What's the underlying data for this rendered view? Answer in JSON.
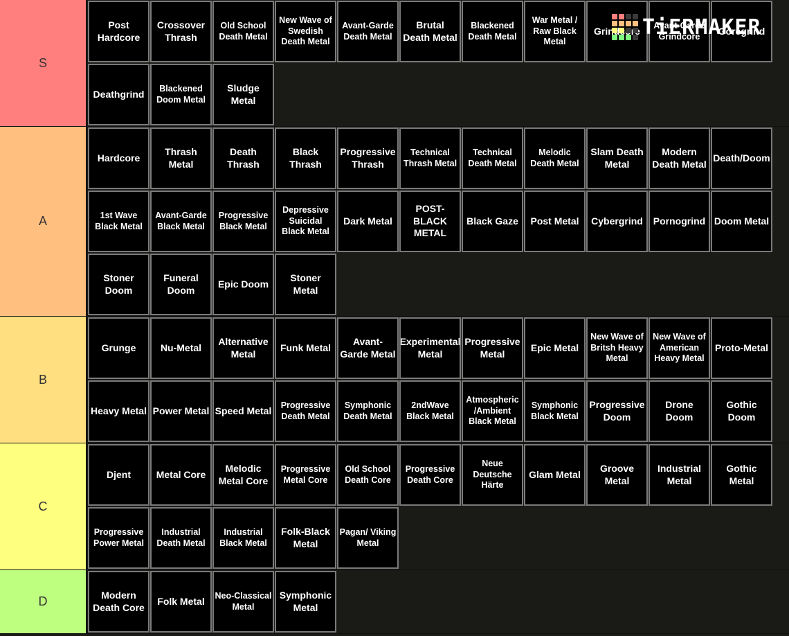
{
  "logo": {
    "text": "TiERMAKER",
    "grid_colors": [
      "#ff7f7f",
      "#ff7f7f",
      "#3a3a3a",
      "#3a3a3a",
      "#ffbf7f",
      "#ffbf7f",
      "#ffbf7f",
      "#ffbf7f",
      "#ffff7f",
      "#ffff7f",
      "#3a3a3a",
      "#3a3a3a",
      "#7fff7f",
      "#7fff7f",
      "#7fff7f",
      "#3a3a3a"
    ]
  },
  "tiers": [
    {
      "label": "S",
      "color": "#ff7f7f",
      "items": [
        "Post Hardcore",
        "Crossover Thrash",
        "Old School Death Metal",
        "New Wave of Swedish Death Metal",
        "Avant-Garde Death Metal",
        "Brutal Death Metal",
        "Blackened Death Metal",
        "War Metal / Raw Black Metal",
        "Grindcore",
        "Avant-Garde Grindcore",
        "Goregrind",
        "Deathgrind",
        "Blackened Doom Metal",
        "Sludge Metal"
      ]
    },
    {
      "label": "A",
      "color": "#ffbf7f",
      "items": [
        "Hardcore",
        "Thrash Metal",
        "Death Thrash",
        "Black Thrash",
        "Progressive Thrash",
        "Technical Thrash Metal",
        "Technical Death Metal",
        "Melodic Death Metal",
        "Slam Death Metal",
        "Modern Death Metal",
        "Death/Doom",
        "1st Wave Black Metal",
        "Avant-Garde Black Metal",
        "Progressive Black Metal",
        "Depressive Suicidal Black Metal",
        "Dark Metal",
        "POST-BLACK METAL",
        "Black Gaze",
        "Post Metal",
        "Cybergrind",
        "Pornogrind",
        "Doom Metal",
        "Stoner Doom",
        "Funeral Doom",
        "Epic Doom",
        "Stoner Metal"
      ]
    },
    {
      "label": "B",
      "color": "#ffdf7f",
      "items": [
        "Grunge",
        "Nu-Metal",
        "Alternative Metal",
        "Funk Metal",
        "Avant-Garde Metal",
        "Experimental Metal",
        "Progressive Metal",
        "Epic Metal",
        "New Wave of Britsh Heavy Metal",
        "New Wave of American Heavy Metal",
        "Proto-Metal",
        "Heavy Metal",
        "Power Metal",
        "Speed Metal",
        "Progressive Death Metal",
        "Symphonic Death Metal",
        "2ndWave Black Metal",
        "Atmospheric /Ambient Black Metal",
        "Symphonic Black Metal",
        "Progressive Doom",
        "Drone Doom",
        "Gothic Doom"
      ]
    },
    {
      "label": "C",
      "color": "#ffff7f",
      "items": [
        "Djent",
        "Metal Core",
        "Melodic Metal Core",
        "Progressive Metal Core",
        "Old School Death Core",
        "Progressive Death Core",
        "Neue Deutsche Härte",
        "Glam Metal",
        "Groove Metal",
        "Industrial Metal",
        "Gothic Metal",
        "Progressive Power Metal",
        "Industrial Death Metal",
        "Industrial Black Metal",
        "Folk-Black Metal",
        "Pagan/ Viking Metal"
      ]
    },
    {
      "label": "D",
      "color": "#bfff7f",
      "items": [
        "Modern Death Core",
        "Folk Metal",
        "Neo-Classical Metal",
        "Symphonic Metal"
      ]
    }
  ]
}
